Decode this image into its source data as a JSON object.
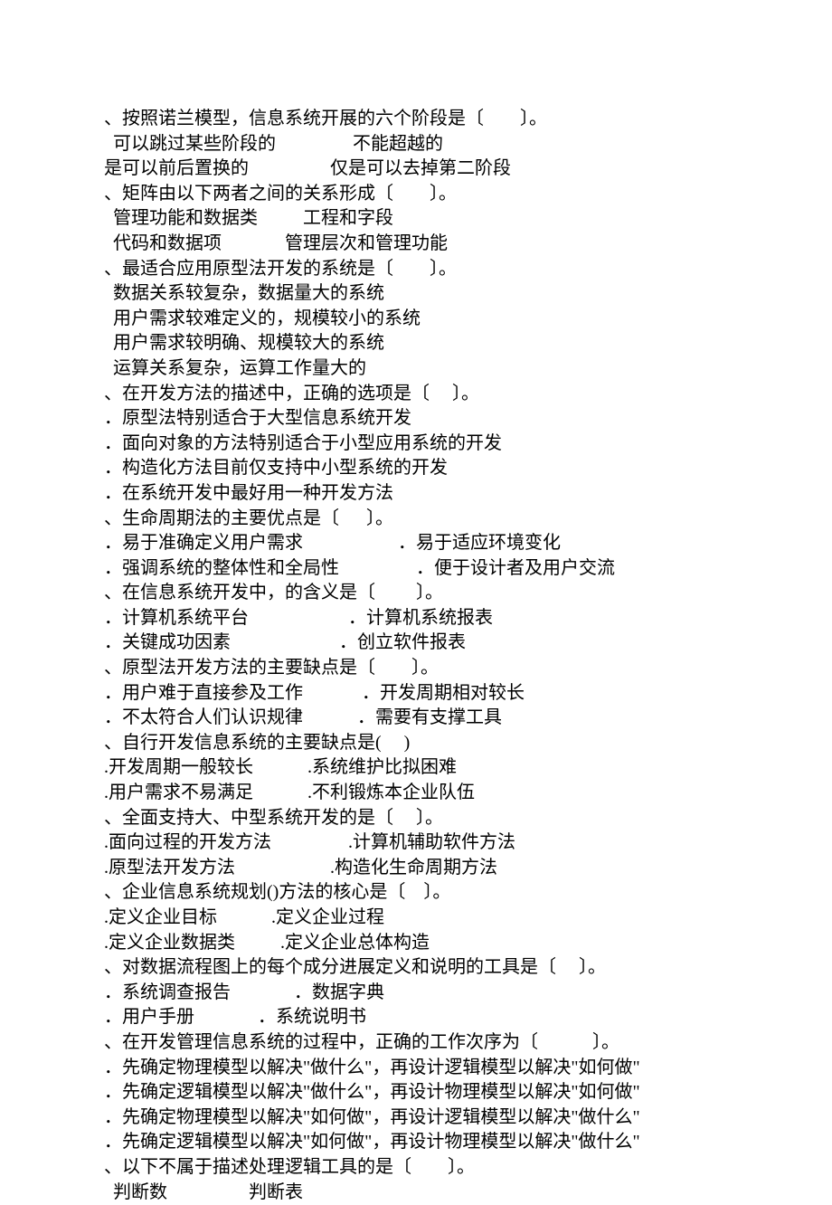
{
  "lines": [
    "、按照诺兰模型，信息系统开展的六个阶段是〔　　〕。",
    "  可以跳过某些阶段的                 不能超越的",
    "是可以前后置换的                  仅是可以去掉第二阶段",
    "、矩阵由以下两者之间的关系形成〔　　〕。",
    "  管理功能和数据类          工程和字段",
    "  代码和数据项              管理层次和管理功能",
    "、最适合应用原型法开发的系统是〔　　〕。",
    "  数据关系较复杂，数据量大的系统",
    "  用户需求较难定义的，规模较小的系统",
    "  用户需求较明确、规模较大的系统",
    "  运算关系复杂，运算工作量大的",
    "、在开发方法的描述中，正确的选项是〔　 〕。",
    "．原型法特别适合于大型信息系统开发",
    "．面向对象的方法特别适合于小型应用系统的开发",
    "．构造化方法目前仅支持中小型系统的开发",
    "．在系统开发中最好用一种开发方法",
    "、生命周期法的主要优点是〔　  〕。",
    "．易于准确定义用户需求                     ．易于适应环境变化",
    "．强调系统的整体性和全局性                 ．便于设计者及用户交流",
    "、在信息系统开发中，的含义是〔　　 〕。",
    "．计算机系统平台                      ．计算机系统报表",
    "．关键成功因素                        ．创立软件报表",
    "、原型法开发方法的主要缺点是〔　　〕。",
    "．用户难于直接参及工作             ．开发周期相对较长",
    "．不太符合人们认识规律            ．需要有支撑工具",
    "、自行开发信息系统的主要缺点是(     )",
    ".开发周期一般较长            .系统维护比拟困难",
    ".用户需求不易满足            .不利锻炼本企业队伍",
    "、全面支持大、中型系统开发的是〔　 〕。",
    ".面向过程的开发方法                 .计算机辅助软件方法",
    ".原型法开发方法                     .构造化生命周期方法",
    "、企业信息系统规划()方法的核心是〔　〕。",
    ".定义企业目标            .定义企业过程",
    ".定义企业数据类          .定义企业总体构造",
    "、对数据流程图上的每个成分进展定义和说明的工具是〔　 〕。",
    "．系统调查报告              ．数据字典",
    "．用户手册              ．系统说明书",
    "、在开发管理信息系统的过程中，正确的工作次序为〔　　　〕。",
    "．先确定物理模型以解决\"做什么\"，再设计逻辑模型以解决\"如何做\"",
    "．先确定逻辑模型以解决\"做什么\"，再设计物理模型以解决\"如何做\"",
    "．先确定物理模型以解决\"如何做\"，再设计逻辑模型以解决\"做什么\"",
    "．先确定逻辑模型以解决\"如何做\"，再设计物理模型以解决\"做什么\"",
    "、以下不属于描述处理逻辑工具的是〔　　〕。",
    "  判断数                  判断表"
  ]
}
